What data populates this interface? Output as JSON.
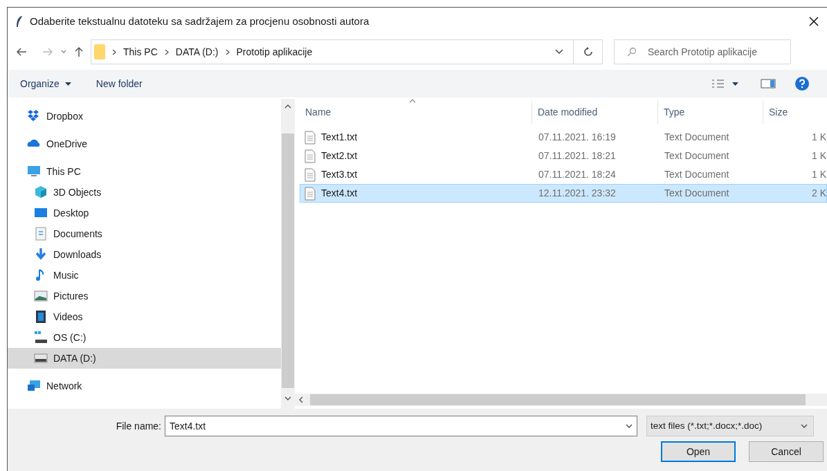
{
  "window": {
    "title": "Odaberite tekstualnu datoteku sa sadržajem za procjenu osobnosti autora"
  },
  "address_bar": {
    "crumbs": [
      "This PC",
      "DATA (D:)",
      "Prototip aplikacije"
    ]
  },
  "search": {
    "placeholder": "Search Prototip aplikacije"
  },
  "toolbar": {
    "buttons": [
      {
        "label": "Organize",
        "kind": "menu"
      },
      {
        "label": "New folder",
        "kind": "plain"
      }
    ]
  },
  "sidebar": {
    "items": [
      {
        "label": "Dropbox",
        "kind": "dropbox",
        "selected": false
      },
      {
        "label": "OneDrive",
        "kind": "cloud",
        "selected": false
      },
      {
        "label": "This PC",
        "kind": "pc",
        "selected": false,
        "children": [
          {
            "label": "3D Objects",
            "kind": "cube",
            "selected": false
          },
          {
            "label": "Desktop",
            "kind": "desktop",
            "selected": false
          },
          {
            "label": "Documents",
            "kind": "document",
            "selected": false
          },
          {
            "label": "Downloads",
            "kind": "download",
            "selected": false
          },
          {
            "label": "Music",
            "kind": "music",
            "selected": false
          },
          {
            "label": "Pictures",
            "kind": "pictures",
            "selected": false
          },
          {
            "label": "Videos",
            "kind": "video",
            "selected": false
          },
          {
            "label": "OS (C:)",
            "kind": "osdrive",
            "selected": false
          },
          {
            "label": "DATA (D:)",
            "kind": "drive",
            "selected": true
          }
        ]
      },
      {
        "label": "Network",
        "kind": "network",
        "selected": false
      }
    ]
  },
  "table": {
    "columns": [
      "Name",
      "Date modified",
      "Type",
      "Size"
    ],
    "rows": [
      {
        "name": "Text1.txt",
        "date": "07.11.2021. 16:19",
        "type": "Text Document",
        "size": "1 K",
        "selected": false
      },
      {
        "name": "Text2.txt",
        "date": "07.11.2021. 18:21",
        "type": "Text Document",
        "size": "1 K",
        "selected": false
      },
      {
        "name": "Text3.txt",
        "date": "07.11.2021. 18:24",
        "type": "Text Document",
        "size": "1 K",
        "selected": false
      },
      {
        "name": "Text4.txt",
        "date": "12.11.2021. 23:32",
        "type": "Text Document",
        "size": "2 K",
        "selected": true
      }
    ]
  },
  "file_name": {
    "label": "File name:",
    "value": "Text4.txt"
  },
  "file_type": {
    "value": "text files (*.txt;*.docx;*.doc)"
  },
  "buttons": [
    {
      "label": "Open",
      "default": true
    },
    {
      "label": "Cancel",
      "default": false
    }
  ]
}
